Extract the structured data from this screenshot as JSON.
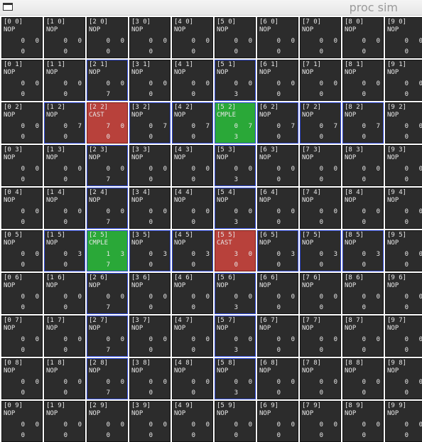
{
  "window": {
    "title": "proc sim"
  },
  "grid": {
    "rows": [
      [
        {
          "label": "[0 0]",
          "op": "NOP",
          "a": "0",
          "b": "0",
          "c": "0",
          "state": "normal"
        },
        {
          "label": "[1 0]",
          "op": "NOP",
          "a": "0",
          "b": "0",
          "c": "0",
          "state": "normal"
        },
        {
          "label": "[2 0]",
          "op": "NOP",
          "a": "0",
          "b": "0",
          "c": "0",
          "state": "normal"
        },
        {
          "label": "[3 0]",
          "op": "NOP",
          "a": "0",
          "b": "0",
          "c": "0",
          "state": "normal"
        },
        {
          "label": "[4 0]",
          "op": "NOP",
          "a": "0",
          "b": "0",
          "c": "0",
          "state": "normal"
        },
        {
          "label": "[5 0]",
          "op": "NOP",
          "a": "0",
          "b": "0",
          "c": "0",
          "state": "normal"
        },
        {
          "label": "[6 0]",
          "op": "NOP",
          "a": "0",
          "b": "0",
          "c": "0",
          "state": "normal"
        },
        {
          "label": "[7 0]",
          "op": "NOP",
          "a": "0",
          "b": "0",
          "c": "0",
          "state": "normal"
        },
        {
          "label": "[8 0]",
          "op": "NOP",
          "a": "0",
          "b": "0",
          "c": "0",
          "state": "normal"
        },
        {
          "label": "[9 0]",
          "op": "NOP",
          "a": "0",
          "b": "0",
          "c": "0",
          "state": "normal"
        }
      ],
      [
        {
          "label": "[0 1]",
          "op": "NOP",
          "a": "0",
          "b": "0",
          "c": "0",
          "state": "normal"
        },
        {
          "label": "[1 1]",
          "op": "NOP",
          "a": "0",
          "b": "0",
          "c": "0",
          "state": "normal"
        },
        {
          "label": "[2 1]",
          "op": "NOP",
          "a": "0",
          "b": "0",
          "c": "7",
          "state": "blue"
        },
        {
          "label": "[3 1]",
          "op": "NOP",
          "a": "0",
          "b": "0",
          "c": "0",
          "state": "normal"
        },
        {
          "label": "[4 1]",
          "op": "NOP",
          "a": "0",
          "b": "0",
          "c": "0",
          "state": "normal"
        },
        {
          "label": "[5 1]",
          "op": "NOP",
          "a": "0",
          "b": "0",
          "c": "3",
          "state": "blue"
        },
        {
          "label": "[6 1]",
          "op": "NOP",
          "a": "0",
          "b": "0",
          "c": "0",
          "state": "normal"
        },
        {
          "label": "[7 1]",
          "op": "NOP",
          "a": "0",
          "b": "0",
          "c": "0",
          "state": "normal"
        },
        {
          "label": "[8 1]",
          "op": "NOP",
          "a": "0",
          "b": "0",
          "c": "0",
          "state": "normal"
        },
        {
          "label": "[9 1]",
          "op": "NOP",
          "a": "0",
          "b": "0",
          "c": "0",
          "state": "normal"
        }
      ],
      [
        {
          "label": "[0 2]",
          "op": "NOP",
          "a": "0",
          "b": "0",
          "c": "0",
          "state": "normal"
        },
        {
          "label": "[1 2]",
          "op": "NOP",
          "a": "0",
          "b": "7",
          "c": "0",
          "state": "blue"
        },
        {
          "label": "[2 2]",
          "op": "CAST",
          "a": "7",
          "b": "0",
          "c": "0",
          "state": "red"
        },
        {
          "label": "[3 2]",
          "op": "NOP",
          "a": "0",
          "b": "7",
          "c": "0",
          "state": "blue"
        },
        {
          "label": "[4 2]",
          "op": "NOP",
          "a": "0",
          "b": "7",
          "c": "0",
          "state": "blue"
        },
        {
          "label": "[5 2]",
          "op": "CMPLE",
          "a": "0",
          "b": "7",
          "c": "3",
          "state": "green"
        },
        {
          "label": "[6 2]",
          "op": "NOP",
          "a": "0",
          "b": "7",
          "c": "0",
          "state": "blue"
        },
        {
          "label": "[7 2]",
          "op": "NOP",
          "a": "0",
          "b": "7",
          "c": "0",
          "state": "blue"
        },
        {
          "label": "[8 2]",
          "op": "NOP",
          "a": "0",
          "b": "7",
          "c": "0",
          "state": "blue"
        },
        {
          "label": "[9 2]",
          "op": "NOP",
          "a": "0",
          "b": "0",
          "c": "0",
          "state": "normal"
        }
      ],
      [
        {
          "label": "[0 3]",
          "op": "NOP",
          "a": "0",
          "b": "0",
          "c": "0",
          "state": "normal"
        },
        {
          "label": "[1 3]",
          "op": "NOP",
          "a": "0",
          "b": "0",
          "c": "0",
          "state": "normal"
        },
        {
          "label": "[2 3]",
          "op": "NOP",
          "a": "0",
          "b": "0",
          "c": "7",
          "state": "blue"
        },
        {
          "label": "[3 3]",
          "op": "NOP",
          "a": "0",
          "b": "0",
          "c": "0",
          "state": "normal"
        },
        {
          "label": "[4 3]",
          "op": "NOP",
          "a": "0",
          "b": "0",
          "c": "0",
          "state": "normal"
        },
        {
          "label": "[5 3]",
          "op": "NOP",
          "a": "0",
          "b": "0",
          "c": "3",
          "state": "blue"
        },
        {
          "label": "[6 3]",
          "op": "NOP",
          "a": "0",
          "b": "0",
          "c": "0",
          "state": "normal"
        },
        {
          "label": "[7 3]",
          "op": "NOP",
          "a": "0",
          "b": "0",
          "c": "0",
          "state": "normal"
        },
        {
          "label": "[8 3]",
          "op": "NOP",
          "a": "0",
          "b": "0",
          "c": "0",
          "state": "normal"
        },
        {
          "label": "[9 3]",
          "op": "NOP",
          "a": "0",
          "b": "0",
          "c": "0",
          "state": "normal"
        }
      ],
      [
        {
          "label": "[0 4]",
          "op": "NOP",
          "a": "0",
          "b": "0",
          "c": "0",
          "state": "normal"
        },
        {
          "label": "[1 4]",
          "op": "NOP",
          "a": "0",
          "b": "0",
          "c": "0",
          "state": "normal"
        },
        {
          "label": "[2 4]",
          "op": "NOP",
          "a": "0",
          "b": "0",
          "c": "7",
          "state": "blue"
        },
        {
          "label": "[3 4]",
          "op": "NOP",
          "a": "0",
          "b": "0",
          "c": "0",
          "state": "normal"
        },
        {
          "label": "[4 4]",
          "op": "NOP",
          "a": "0",
          "b": "0",
          "c": "0",
          "state": "normal"
        },
        {
          "label": "[5 4]",
          "op": "NOP",
          "a": "0",
          "b": "0",
          "c": "3",
          "state": "blue"
        },
        {
          "label": "[6 4]",
          "op": "NOP",
          "a": "0",
          "b": "0",
          "c": "0",
          "state": "normal"
        },
        {
          "label": "[7 4]",
          "op": "NOP",
          "a": "0",
          "b": "0",
          "c": "0",
          "state": "normal"
        },
        {
          "label": "[8 4]",
          "op": "NOP",
          "a": "0",
          "b": "0",
          "c": "0",
          "state": "normal"
        },
        {
          "label": "[9 4]",
          "op": "NOP",
          "a": "0",
          "b": "0",
          "c": "0",
          "state": "normal"
        }
      ],
      [
        {
          "label": "[0 5]",
          "op": "NOP",
          "a": "0",
          "b": "0",
          "c": "0",
          "state": "normal"
        },
        {
          "label": "[1 5]",
          "op": "NOP",
          "a": "0",
          "b": "3",
          "c": "0",
          "state": "blue"
        },
        {
          "label": "[2 5]",
          "op": "CMPLE",
          "a": "1",
          "b": "3",
          "c": "7",
          "state": "green"
        },
        {
          "label": "[3 5]",
          "op": "NOP",
          "a": "0",
          "b": "3",
          "c": "0",
          "state": "blue"
        },
        {
          "label": "[4 5]",
          "op": "NOP",
          "a": "0",
          "b": "3",
          "c": "0",
          "state": "blue"
        },
        {
          "label": "[5 5]",
          "op": "CAST",
          "a": "3",
          "b": "0",
          "c": "0",
          "state": "red"
        },
        {
          "label": "[6 5]",
          "op": "NOP",
          "a": "0",
          "b": "3",
          "c": "0",
          "state": "blue"
        },
        {
          "label": "[7 5]",
          "op": "NOP",
          "a": "0",
          "b": "3",
          "c": "0",
          "state": "blue"
        },
        {
          "label": "[8 5]",
          "op": "NOP",
          "a": "0",
          "b": "3",
          "c": "0",
          "state": "blue"
        },
        {
          "label": "[9 5]",
          "op": "NOP",
          "a": "0",
          "b": "0",
          "c": "0",
          "state": "normal"
        }
      ],
      [
        {
          "label": "[0 6]",
          "op": "NOP",
          "a": "0",
          "b": "0",
          "c": "0",
          "state": "normal"
        },
        {
          "label": "[1 6]",
          "op": "NOP",
          "a": "0",
          "b": "0",
          "c": "0",
          "state": "normal"
        },
        {
          "label": "[2 6]",
          "op": "NOP",
          "a": "0",
          "b": "0",
          "c": "7",
          "state": "blue"
        },
        {
          "label": "[3 6]",
          "op": "NOP",
          "a": "0",
          "b": "0",
          "c": "0",
          "state": "normal"
        },
        {
          "label": "[4 6]",
          "op": "NOP",
          "a": "0",
          "b": "0",
          "c": "0",
          "state": "normal"
        },
        {
          "label": "[5 6]",
          "op": "NOP",
          "a": "0",
          "b": "0",
          "c": "3",
          "state": "blue"
        },
        {
          "label": "[6 6]",
          "op": "NOP",
          "a": "0",
          "b": "0",
          "c": "0",
          "state": "normal"
        },
        {
          "label": "[7 6]",
          "op": "NOP",
          "a": "0",
          "b": "0",
          "c": "0",
          "state": "normal"
        },
        {
          "label": "[8 6]",
          "op": "NOP",
          "a": "0",
          "b": "0",
          "c": "0",
          "state": "normal"
        },
        {
          "label": "[9 6]",
          "op": "NOP",
          "a": "0",
          "b": "0",
          "c": "0",
          "state": "normal"
        }
      ],
      [
        {
          "label": "[0 7]",
          "op": "NOP",
          "a": "0",
          "b": "0",
          "c": "0",
          "state": "normal"
        },
        {
          "label": "[1 7]",
          "op": "NOP",
          "a": "0",
          "b": "0",
          "c": "0",
          "state": "normal"
        },
        {
          "label": "[2 7]",
          "op": "NOP",
          "a": "0",
          "b": "0",
          "c": "7",
          "state": "blue"
        },
        {
          "label": "[3 7]",
          "op": "NOP",
          "a": "0",
          "b": "0",
          "c": "0",
          "state": "normal"
        },
        {
          "label": "[4 7]",
          "op": "NOP",
          "a": "0",
          "b": "0",
          "c": "0",
          "state": "normal"
        },
        {
          "label": "[5 7]",
          "op": "NOP",
          "a": "0",
          "b": "0",
          "c": "3",
          "state": "blue"
        },
        {
          "label": "[6 7]",
          "op": "NOP",
          "a": "0",
          "b": "0",
          "c": "0",
          "state": "normal"
        },
        {
          "label": "[7 7]",
          "op": "NOP",
          "a": "0",
          "b": "0",
          "c": "0",
          "state": "normal"
        },
        {
          "label": "[8 7]",
          "op": "NOP",
          "a": "0",
          "b": "0",
          "c": "0",
          "state": "normal"
        },
        {
          "label": "[9 7]",
          "op": "NOP",
          "a": "0",
          "b": "0",
          "c": "0",
          "state": "normal"
        }
      ],
      [
        {
          "label": "[0 8]",
          "op": "NOP",
          "a": "0",
          "b": "0",
          "c": "0",
          "state": "normal"
        },
        {
          "label": "[1 8]",
          "op": "NOP",
          "a": "0",
          "b": "0",
          "c": "0",
          "state": "normal"
        },
        {
          "label": "[2 8]",
          "op": "NOP",
          "a": "0",
          "b": "0",
          "c": "7",
          "state": "blue"
        },
        {
          "label": "[3 8]",
          "op": "NOP",
          "a": "0",
          "b": "0",
          "c": "0",
          "state": "normal"
        },
        {
          "label": "[4 8]",
          "op": "NOP",
          "a": "0",
          "b": "0",
          "c": "0",
          "state": "normal"
        },
        {
          "label": "[5 8]",
          "op": "NOP",
          "a": "0",
          "b": "0",
          "c": "3",
          "state": "blue"
        },
        {
          "label": "[6 8]",
          "op": "NOP",
          "a": "0",
          "b": "0",
          "c": "0",
          "state": "normal"
        },
        {
          "label": "[7 8]",
          "op": "NOP",
          "a": "0",
          "b": "0",
          "c": "0",
          "state": "normal"
        },
        {
          "label": "[8 8]",
          "op": "NOP",
          "a": "0",
          "b": "0",
          "c": "0",
          "state": "normal"
        },
        {
          "label": "[9 8]",
          "op": "NOP",
          "a": "0",
          "b": "0",
          "c": "0",
          "state": "normal"
        }
      ],
      [
        {
          "label": "[0 9]",
          "op": "NOP",
          "a": "0",
          "b": "0",
          "c": "0",
          "state": "normal"
        },
        {
          "label": "[1 9]",
          "op": "NOP",
          "a": "0",
          "b": "0",
          "c": "0",
          "state": "normal"
        },
        {
          "label": "[2 9]",
          "op": "NOP",
          "a": "0",
          "b": "0",
          "c": "0",
          "state": "normal"
        },
        {
          "label": "[3 9]",
          "op": "NOP",
          "a": "0",
          "b": "0",
          "c": "0",
          "state": "normal"
        },
        {
          "label": "[4 9]",
          "op": "NOP",
          "a": "0",
          "b": "0",
          "c": "0",
          "state": "normal"
        },
        {
          "label": "[5 9]",
          "op": "NOP",
          "a": "0",
          "b": "0",
          "c": "0",
          "state": "normal"
        },
        {
          "label": "[6 9]",
          "op": "NOP",
          "a": "0",
          "b": "0",
          "c": "0",
          "state": "normal"
        },
        {
          "label": "[7 9]",
          "op": "NOP",
          "a": "0",
          "b": "0",
          "c": "0",
          "state": "normal"
        },
        {
          "label": "[8 9]",
          "op": "NOP",
          "a": "0",
          "b": "0",
          "c": "0",
          "state": "normal"
        },
        {
          "label": "[9 9]",
          "op": "NOP",
          "a": "0",
          "b": "0",
          "c": "0",
          "state": "normal"
        }
      ]
    ]
  },
  "colors": {
    "cell_bg": "#2c2c2c",
    "cast_bg": "#b8413b",
    "cmple_bg": "#2aa838",
    "active_border": "#2f49d6",
    "title_text": "#9a9a9a"
  },
  "icons": {
    "window": "window-icon"
  }
}
